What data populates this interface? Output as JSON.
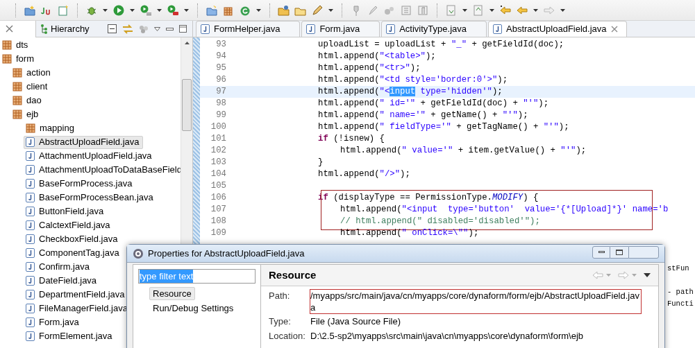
{
  "left_panel": {
    "tabs": [
      {
        "label": "Hierarchy",
        "selected": false
      }
    ],
    "tree": [
      {
        "label": "dts",
        "kind": "package",
        "selected": false
      },
      {
        "label": "form",
        "kind": "package",
        "selected": false,
        "children": [
          {
            "label": "action",
            "kind": "package",
            "selected": false
          },
          {
            "label": "client",
            "kind": "package",
            "selected": false
          },
          {
            "label": "dao",
            "kind": "package",
            "selected": false
          },
          {
            "label": "ejb",
            "kind": "package",
            "selected": false,
            "children": [
              {
                "label": "mapping",
                "kind": "package",
                "selected": false
              },
              {
                "label": "AbstractUploadField.java",
                "kind": "file",
                "selected": true
              },
              {
                "label": "AttachmentUploadField.java",
                "kind": "file",
                "selected": false
              },
              {
                "label": "AttachmentUploadToDataBaseField",
                "kind": "file",
                "selected": false
              },
              {
                "label": "BaseFormProcess.java",
                "kind": "file",
                "selected": false
              },
              {
                "label": "BaseFormProcessBean.java",
                "kind": "file",
                "selected": false
              },
              {
                "label": "ButtonField.java",
                "kind": "file",
                "selected": false
              },
              {
                "label": "CalctextField.java",
                "kind": "file",
                "selected": false
              },
              {
                "label": "CheckboxField.java",
                "kind": "file",
                "selected": false
              },
              {
                "label": "ComponentTag.java",
                "kind": "file",
                "selected": false
              },
              {
                "label": "Confirm.java",
                "kind": "file",
                "selected": false
              },
              {
                "label": "DateField.java",
                "kind": "file",
                "selected": false
              },
              {
                "label": "DepartmentField.java",
                "kind": "file",
                "selected": false
              },
              {
                "label": "FileManagerField.java",
                "kind": "file",
                "selected": false
              },
              {
                "label": "Form.java",
                "kind": "file",
                "selected": false
              },
              {
                "label": "FormElement.java",
                "kind": "file",
                "selected": false
              }
            ]
          }
        ]
      }
    ]
  },
  "editor": {
    "tabs": [
      {
        "label": "FormHelper.java",
        "selected": false
      },
      {
        "label": "Form.java",
        "selected": false
      },
      {
        "label": "ActivityType.java",
        "selected": false
      },
      {
        "label": "AbstractUploadField.java",
        "selected": true
      }
    ],
    "lines": [
      {
        "number": "93",
        "kind": "statement",
        "current": false,
        "boxed": false,
        "tokens": [
          {
            "kind": "plain",
            "text": "uploadList = uploadList + "
          },
          {
            "kind": "string",
            "text": "\"_\""
          },
          {
            "kind": "plain",
            "text": " + getFieldId(doc);"
          }
        ]
      },
      {
        "number": "94",
        "kind": "statement",
        "current": false,
        "boxed": false,
        "tokens": [
          {
            "kind": "plain",
            "text": "html.append("
          },
          {
            "kind": "string",
            "text": "\"<table>\""
          },
          {
            "kind": "plain",
            "text": ");"
          }
        ]
      },
      {
        "number": "95",
        "kind": "statement",
        "current": false,
        "boxed": false,
        "tokens": [
          {
            "kind": "plain",
            "text": "html.append("
          },
          {
            "kind": "string",
            "text": "\"<tr>\""
          },
          {
            "kind": "plain",
            "text": ");"
          }
        ]
      },
      {
        "number": "96",
        "kind": "statement",
        "current": false,
        "boxed": false,
        "tokens": [
          {
            "kind": "plain",
            "text": "html.append("
          },
          {
            "kind": "string",
            "text": "\"<td style='border:0'>\""
          },
          {
            "kind": "plain",
            "text": ");"
          }
        ]
      },
      {
        "number": "97",
        "kind": "statement",
        "current": true,
        "boxed": false,
        "tokens": [
          {
            "kind": "plain",
            "text": "html.append("
          },
          {
            "kind": "string",
            "text": "\"<"
          },
          {
            "kind": "selected",
            "text": "input"
          },
          {
            "kind": "string",
            "text": " type='hidden'\""
          },
          {
            "kind": "plain",
            "text": ");"
          }
        ]
      },
      {
        "number": "98",
        "kind": "statement",
        "current": false,
        "boxed": false,
        "tokens": [
          {
            "kind": "plain",
            "text": "html.append("
          },
          {
            "kind": "string",
            "text": "\" id='\""
          },
          {
            "kind": "plain",
            "text": " + getFieldId(doc) + "
          },
          {
            "kind": "string",
            "text": "\"'\""
          },
          {
            "kind": "plain",
            "text": ");"
          }
        ]
      },
      {
        "number": "99",
        "kind": "statement",
        "current": false,
        "boxed": false,
        "tokens": [
          {
            "kind": "plain",
            "text": "html.append("
          },
          {
            "kind": "string",
            "text": "\" name='\""
          },
          {
            "kind": "plain",
            "text": " + getName() + "
          },
          {
            "kind": "string",
            "text": "\"'\""
          },
          {
            "kind": "plain",
            "text": ");"
          }
        ]
      },
      {
        "number": "100",
        "kind": "statement",
        "current": false,
        "boxed": false,
        "tokens": [
          {
            "kind": "plain",
            "text": "html.append("
          },
          {
            "kind": "string",
            "text": "\" fieldType='\""
          },
          {
            "kind": "plain",
            "text": " + getTagName() + "
          },
          {
            "kind": "string",
            "text": "\"'\""
          },
          {
            "kind": "plain",
            "text": ");"
          }
        ]
      },
      {
        "number": "101",
        "kind": "statement",
        "current": false,
        "boxed": false,
        "tokens": [
          {
            "kind": "keyword",
            "text": "if"
          },
          {
            "kind": "plain",
            "text": " (!isnew) {"
          }
        ]
      },
      {
        "number": "102",
        "kind": "nested",
        "current": false,
        "boxed": false,
        "tokens": [
          {
            "kind": "plain",
            "text": "html.append("
          },
          {
            "kind": "string",
            "text": "\" value='\""
          },
          {
            "kind": "plain",
            "text": " + item.getValue() + "
          },
          {
            "kind": "string",
            "text": "\"'\""
          },
          {
            "kind": "plain",
            "text": ");"
          }
        ]
      },
      {
        "number": "103",
        "kind": "statement",
        "current": false,
        "boxed": false,
        "tokens": [
          {
            "kind": "plain",
            "text": "}"
          }
        ]
      },
      {
        "number": "104",
        "kind": "statement",
        "current": false,
        "boxed": false,
        "tokens": [
          {
            "kind": "plain",
            "text": "html.append("
          },
          {
            "kind": "string",
            "text": "\"/>\""
          },
          {
            "kind": "plain",
            "text": ");"
          }
        ]
      },
      {
        "number": "105",
        "kind": "statement",
        "current": false,
        "boxed": false
      },
      {
        "number": "106",
        "kind": "statement",
        "current": false,
        "boxed": true,
        "tokens": [
          {
            "kind": "keyword",
            "text": "if"
          },
          {
            "kind": "plain",
            "text": " (displayType == PermissionType."
          },
          {
            "kind": "field",
            "text": "MODIFY"
          },
          {
            "kind": "plain",
            "text": ") {"
          }
        ]
      },
      {
        "number": "107",
        "kind": "nested",
        "current": false,
        "boxed": true,
        "tokens": [
          {
            "kind": "plain",
            "text": "html.append("
          },
          {
            "kind": "string",
            "text": "\"<input  type='button'  value='{*[Upload]*}' name='b"
          }
        ]
      },
      {
        "number": "108",
        "kind": "nested",
        "current": false,
        "boxed": true,
        "tokens": [
          {
            "kind": "comment",
            "text": "// html.append(\" disabled='disabled'\");"
          }
        ]
      },
      {
        "number": "109",
        "kind": "nested",
        "current": false,
        "boxed": false,
        "tokens": [
          {
            "kind": "plain",
            "text": "html.append("
          },
          {
            "kind": "string",
            "text": "\" onClick=\\\"\""
          },
          {
            "kind": "plain",
            "text": ");"
          }
        ]
      }
    ],
    "fragments": [
      {
        "text": "stFun",
        "kind": "next"
      },
      {
        "text": "- path",
        "kind": "skip"
      },
      {
        "text": "Functi",
        "kind": "next"
      }
    ]
  },
  "dialog": {
    "title": "Properties for AbstractUploadField.java",
    "filter": {
      "value": "type filter text"
    },
    "nav": [
      {
        "label": "Resource",
        "selected": true
      },
      {
        "label": "Run/Debug Settings",
        "selected": false
      }
    ],
    "heading": "Resource",
    "properties": [
      {
        "label": "Path:",
        "value": "/myapps/src/main/java/cn/myapps/core/dynaform/form/ejb/AbstractUploadField.java",
        "boxed": true
      },
      {
        "label": "Type:",
        "value": "File  (Java Source File)",
        "boxed": false
      },
      {
        "label": "Location:",
        "value": "D:\\2.5-sp2\\myapps\\src\\main\\java\\cn\\myapps\\core\\dynaform\\form\\ejb",
        "boxed": false
      }
    ]
  }
}
